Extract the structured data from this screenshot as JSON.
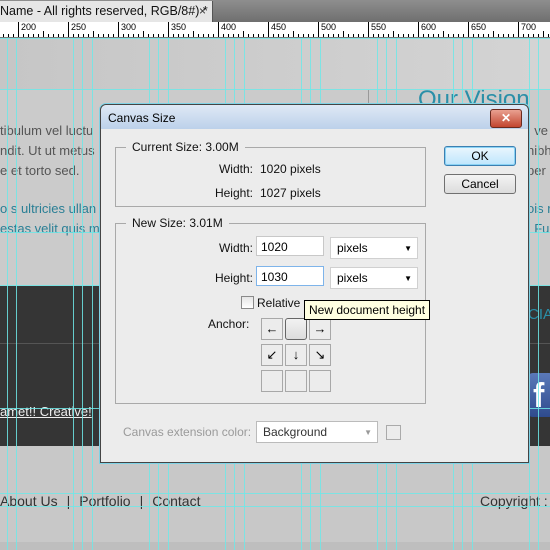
{
  "document_tab": {
    "title": "Name - All rights reserved, RGB/8#) *",
    "close_glyph": "×"
  },
  "ruler": {
    "labels": [
      "200",
      "250",
      "300",
      "350",
      "400",
      "450",
      "500",
      "550",
      "600",
      "650",
      "700"
    ]
  },
  "canvas": {
    "heading": "Our Vision",
    "paragraph_left": [
      "tibulum vel luctu",
      "ndit. Ut ut metus",
      "e et torto sed.",
      "o s ultricies ullan",
      "estas velit quis m"
    ],
    "paragraph_right": [
      ", ve",
      "nibh",
      "per :",
      "ois r",
      ". Fu"
    ],
    "social_heading": "CIA",
    "facebook_glyph": "f",
    "creative_text": "amet!! Creative!",
    "footer_nav": [
      "About Us",
      "Portfolio",
      "Contact"
    ],
    "footer_separator": "|",
    "copyright": "Copyright :"
  },
  "dialog": {
    "title": "Canvas Size",
    "close_glyph": "✕",
    "current_size": {
      "legend": "Current Size: 3.00M",
      "width_label": "Width:",
      "width_value": "1020 pixels",
      "height_label": "Height:",
      "height_value": "1027 pixels"
    },
    "new_size": {
      "legend": "New Size: 3.01M",
      "width_label": "Width:",
      "width_value": "1020",
      "width_unit": "pixels",
      "height_label": "Height:",
      "height_value": "1030",
      "height_unit": "pixels",
      "relative_label": "Relative",
      "relative_checked": false,
      "anchor_label": "Anchor:",
      "anchor_cells": [
        "←",
        "",
        "→",
        "↙",
        "↓",
        "↘",
        "",
        "",
        ""
      ]
    },
    "tooltip": "New document height",
    "ok_label": "OK",
    "cancel_label": "Cancel",
    "extension_color_label": "Canvas extension color:",
    "extension_color_value": "Background"
  },
  "colors": {
    "guide": "#6ee8e8",
    "accent_text": "#2a8fa8",
    "dark_band": "#353535"
  }
}
